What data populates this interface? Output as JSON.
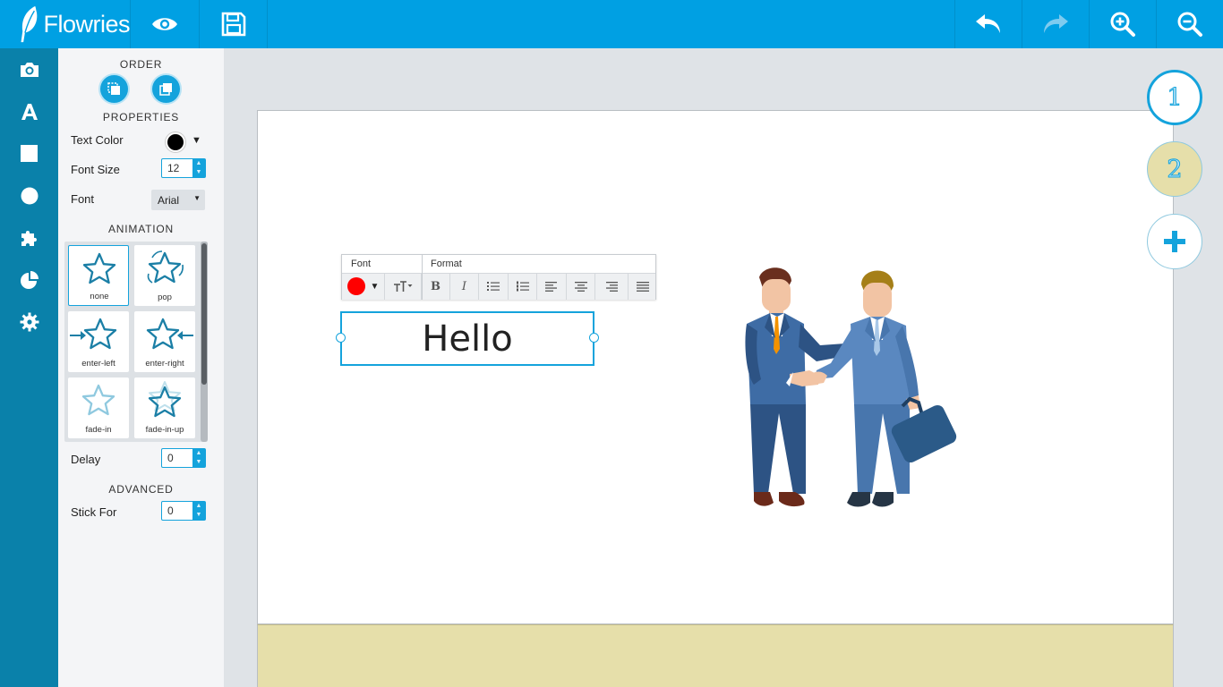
{
  "app": {
    "name": "Flowries"
  },
  "toolbar": {
    "preview": "eye-icon",
    "save": "save-icon",
    "undo": "undo-icon",
    "redo": "redo-icon",
    "zoom_in": "zoom-in-icon",
    "zoom_out": "zoom-out-icon"
  },
  "rail": {
    "items": [
      "camera-icon",
      "text-icon",
      "square-icon",
      "circle-icon",
      "puzzle-icon",
      "pie-chart-icon",
      "gear-icon"
    ]
  },
  "panel": {
    "order_title": "ORDER",
    "properties_title": "PROPERTIES",
    "text_color_label": "Text Color",
    "text_color_value": "#000000",
    "font_size_label": "Font Size",
    "font_size_value": "12",
    "font_label": "Font",
    "font_value": "Arial",
    "animation_title": "ANIMATION",
    "animations": [
      {
        "label": "none",
        "selected": true
      },
      {
        "label": "pop",
        "selected": false
      },
      {
        "label": "enter-left",
        "selected": false
      },
      {
        "label": "enter-right",
        "selected": false
      },
      {
        "label": "fade-in",
        "selected": false
      },
      {
        "label": "fade-in-up",
        "selected": false
      }
    ],
    "delay_label": "Delay",
    "delay_value": "0",
    "advanced_title": "ADVANCED",
    "stick_for_label": "Stick For",
    "stick_for_value": "0"
  },
  "text_toolbar": {
    "font_header": "Font",
    "format_header": "Format",
    "font_color": "#ff0000",
    "bold": "B",
    "italic": "I"
  },
  "canvas": {
    "text": "Hello",
    "footer_color": "#e6dfaa"
  },
  "pages": [
    {
      "label": "1",
      "active": true
    },
    {
      "label": "2",
      "active": false
    }
  ],
  "add_page": "plus-icon",
  "colors": {
    "brand": "#00a0e3",
    "rail": "#0a81aa",
    "accent": "#14a3dc"
  }
}
